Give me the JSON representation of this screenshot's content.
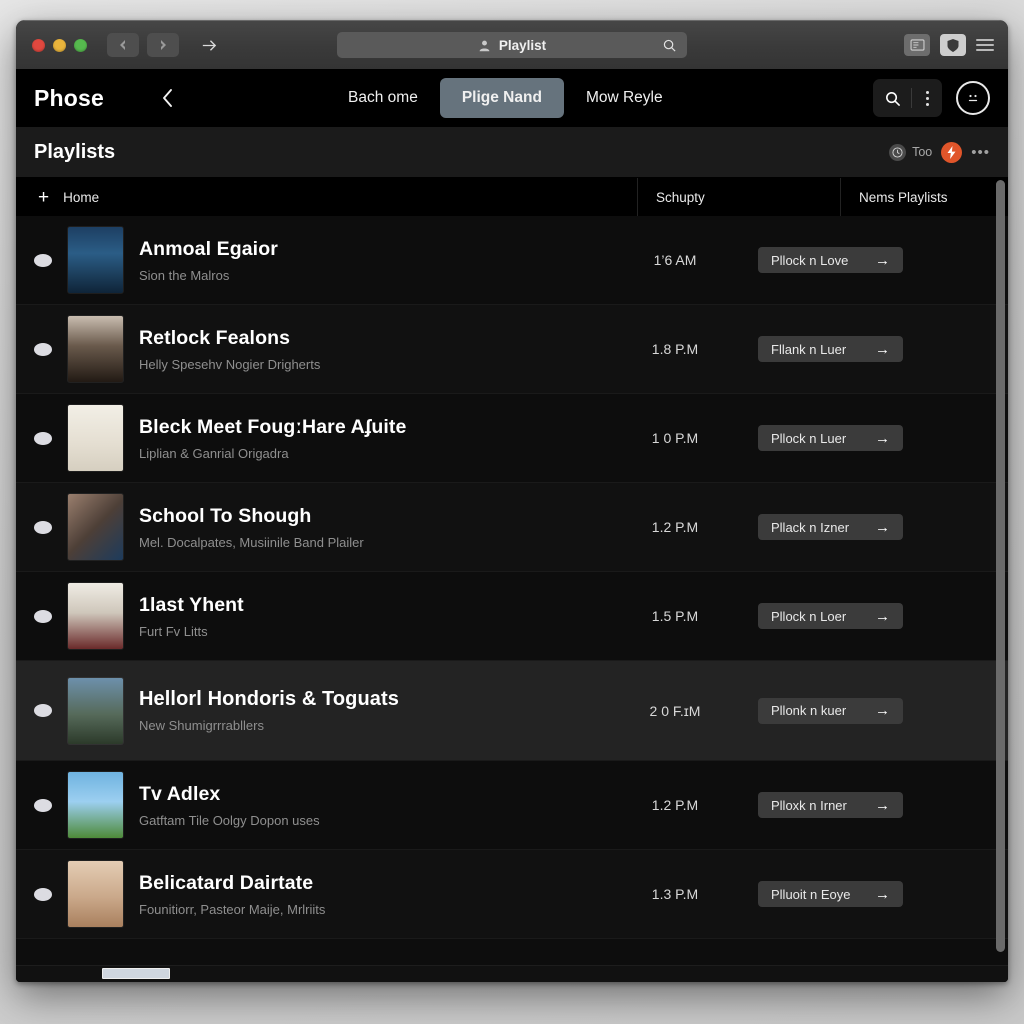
{
  "titlebar": {
    "address_value": "Playlist",
    "person_icon": "person-icon",
    "search_icon": "magnifier-icon",
    "back_icon": "back-arrow-icon",
    "forward_icon": "forward-arrow-icon",
    "share_icon": "share-arrow-icon",
    "reader_icon": "reader-view-icon",
    "shield_icon": "shield-icon",
    "menu_icon": "hamburger-menu-icon"
  },
  "header": {
    "brand": "Phose",
    "back_label": "‹",
    "tabs": [
      {
        "label": "Bach ome",
        "active": false
      },
      {
        "label": "Plige Nand",
        "active": true
      },
      {
        "label": "Mow Reyle",
        "active": false
      }
    ],
    "search_icon": "search-icon",
    "kebab_icon": "more-vertical-icon",
    "avatar_icon": "face-avatar-icon"
  },
  "page": {
    "title": "Playlists",
    "badge_label": "Too",
    "badge_icon": "clock-icon",
    "orange_icon": "flash-icon",
    "overflow_label": "•••"
  },
  "table": {
    "columns": [
      {
        "label": "Home",
        "icon": "plus-icon"
      },
      {
        "label": "Schupty"
      },
      {
        "label": "Nems Playlists"
      }
    ],
    "rows": [
      {
        "title": "Anmoal Egaior",
        "subtitle": "Sion the Malros",
        "time": "1’6 AM",
        "action": "Pllock n Love",
        "thumb": "linear-gradient(180deg,#1d3f63 0%,#2b5d86 40%,#0f2438 100%)",
        "highlight": false
      },
      {
        "title": "Retlock Fealons",
        "subtitle": "Helly Spesehv Nogier Drigherts",
        "time": "1.8 P.M",
        "action": "Fllank n Luer",
        "thumb": "linear-gradient(180deg,#c9bdb0 0%,#6a5a4c 45%,#221a14 100%)",
        "highlight": false
      },
      {
        "title": "Bleck Meet FougːHare Aʄuite",
        "subtitle": "Liplian & Ganrial Origadra",
        "time": "1 0 P.M",
        "action": "Pllock n Luer",
        "thumb": "linear-gradient(180deg,#f2efe6 0%,#e4ded1 60%,#d6cfc0 100%)",
        "highlight": false
      },
      {
        "title": "School To Shough",
        "subtitle": "Mel. Docalpates, Musiinile Band Plailer",
        "time": "1.2 P.M",
        "action": "Pllack n Izner",
        "thumb": "linear-gradient(135deg,#9a7f6e 0%,#4d3f37 50%,#1d3b5c 100%)",
        "highlight": false
      },
      {
        "title": "1last Yhent",
        "subtitle": "Furt Fv Litts",
        "time": "1.5 P.M",
        "action": "Pllock n Loer",
        "thumb": "linear-gradient(180deg,#efece4 0%,#cfc7bb 45%,#6a2a2a 100%)",
        "highlight": false
      },
      {
        "title": "Hellorl Hondoris & Toguats",
        "subtitle": "New Shumigrrrabllers",
        "time": "2 0 F.ɪM",
        "action": "Pllonk n kuer",
        "thumb": "linear-gradient(180deg,#6d90ab 0%,#566a5a 55%,#2c3a2a 100%)",
        "highlight": true
      },
      {
        "title": "Tv Adlex",
        "subtitle": "Gatftam Tile Oolgy Dopon uses",
        "time": "1.2 P.M",
        "action": "Plloxk n Irner",
        "thumb": "linear-gradient(180deg,#6fb3e0 0%,#9ccff0 45%,#4e8a39 100%)",
        "highlight": false
      },
      {
        "title": "Belicatard Dairtate",
        "subtitle": "Founitiorr, Pasteor Maije, Mrlriits",
        "time": "1.3 P.M",
        "action": "Plluoit n Eoye",
        "thumb": "linear-gradient(180deg,#e4cdb4 0%,#caa88a 55%,#a9805e 100%)",
        "highlight": false
      }
    ]
  }
}
